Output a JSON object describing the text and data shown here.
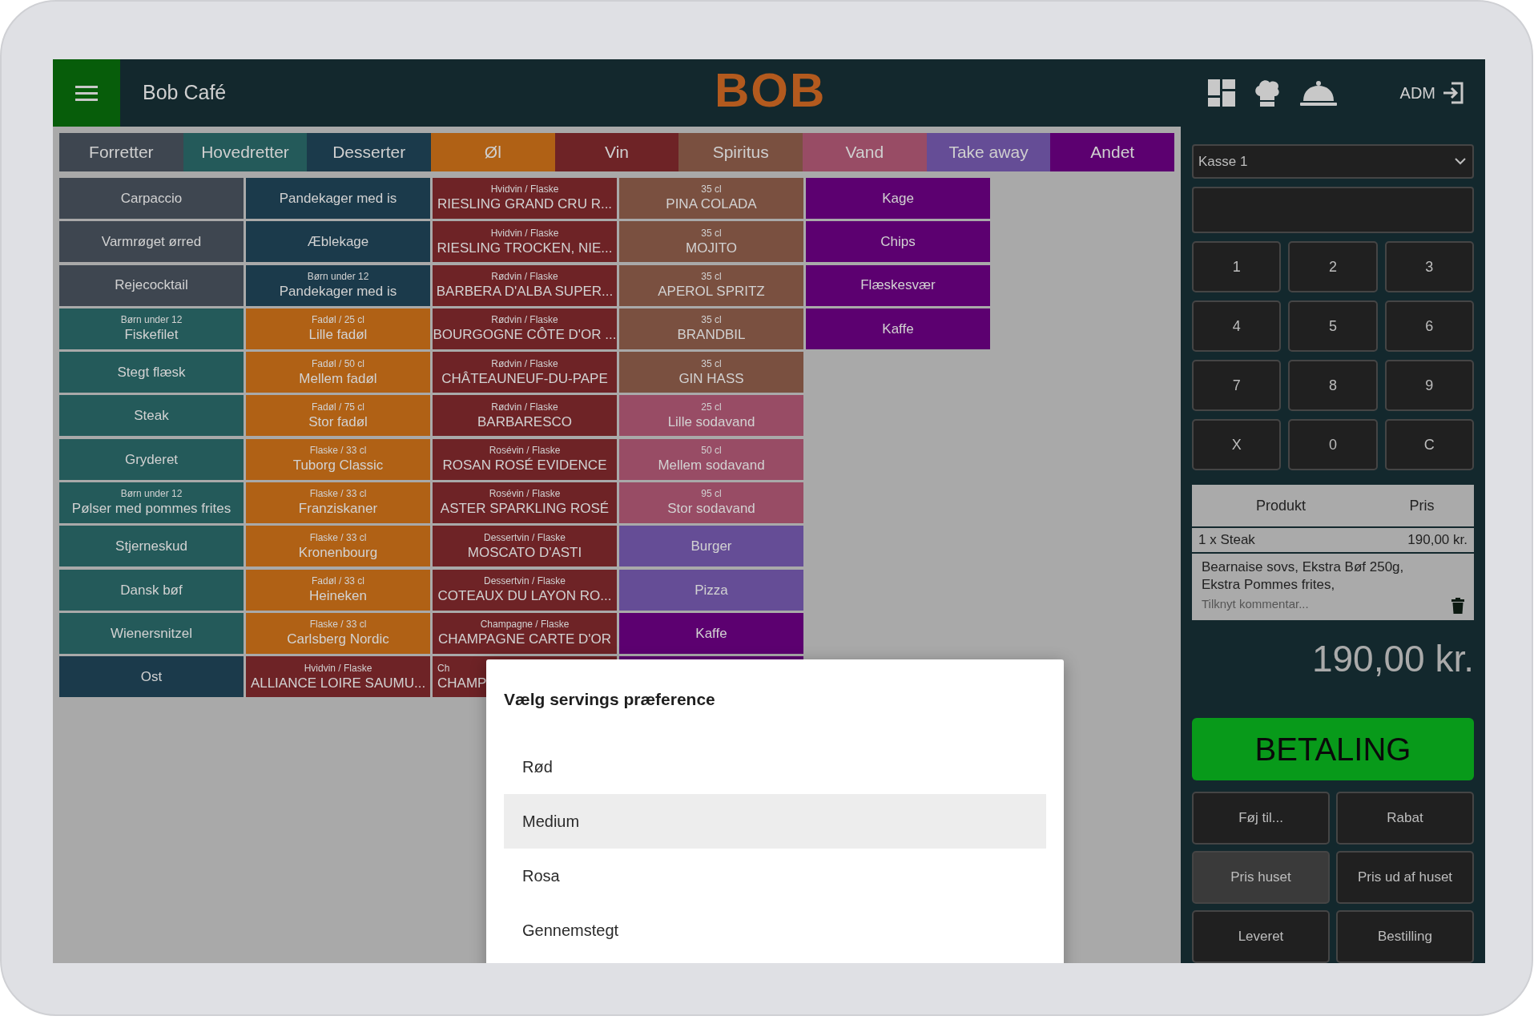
{
  "header": {
    "venue": "Bob Café",
    "logo": "BOB",
    "user": "ADM"
  },
  "categories": [
    {
      "label": "Forretter",
      "color": "#3e4650"
    },
    {
      "label": "Hovedretter",
      "color": "#245a5a"
    },
    {
      "label": "Desserter",
      "color": "#1b3a4b"
    },
    {
      "label": "Øl",
      "color": "#b06115"
    },
    {
      "label": "Vin",
      "color": "#6e2326"
    },
    {
      "label": "Spiritus",
      "color": "#7a5040"
    },
    {
      "label": "Vand",
      "color": "#984c65"
    },
    {
      "label": "Take away",
      "color": "#654d96"
    },
    {
      "label": "Andet",
      "color": "#5c0070"
    }
  ],
  "menu_columns": [
    [
      {
        "name": "Carpaccio",
        "color": "#3e4650"
      },
      {
        "name": "Varmrøget ørred",
        "color": "#3e4650"
      },
      {
        "name": "Rejecocktail",
        "color": "#3e4650"
      },
      {
        "subtitle": "Børn under 12",
        "name": "Fiskefilet",
        "color": "#245a5a"
      },
      {
        "name": "Stegt flæsk",
        "color": "#245a5a"
      },
      {
        "name": "Steak",
        "color": "#245a5a"
      },
      {
        "name": "Gryderet",
        "color": "#245a5a"
      },
      {
        "subtitle": "Børn under 12",
        "name": "Pølser med pommes frites",
        "color": "#245a5a"
      },
      {
        "name": "Stjerneskud",
        "color": "#245a5a"
      },
      {
        "name": "Dansk bøf",
        "color": "#245a5a"
      },
      {
        "name": "Wienersnitzel",
        "color": "#245a5a"
      },
      {
        "name": "Ost",
        "color": "#1b3a4b"
      }
    ],
    [
      {
        "name": "Pandekager med is",
        "color": "#1b3a4b"
      },
      {
        "name": "Æblekage",
        "color": "#1b3a4b"
      },
      {
        "subtitle": "Børn under 12",
        "name": "Pandekager med is",
        "color": "#1b3a4b"
      },
      {
        "subtitle": "Fadøl / 25 cl",
        "name": "Lille fadøl",
        "color": "#b06115"
      },
      {
        "subtitle": "Fadøl / 50 cl",
        "name": "Mellem fadøl",
        "color": "#b06115"
      },
      {
        "subtitle": "Fadøl / 75 cl",
        "name": "Stor fadøl",
        "color": "#b06115"
      },
      {
        "subtitle": "Flaske / 33 cl",
        "name": "Tuborg Classic",
        "color": "#b06115"
      },
      {
        "subtitle": "Flaske / 33 cl",
        "name": "Franziskaner",
        "color": "#b06115"
      },
      {
        "subtitle": "Flaske / 33 cl",
        "name": "Kronenbourg",
        "color": "#b06115"
      },
      {
        "subtitle": "Fadøl / 33 cl",
        "name": "Heineken",
        "color": "#b06115"
      },
      {
        "subtitle": "Flaske / 33 cl",
        "name": "Carlsberg Nordic",
        "color": "#b06115"
      },
      {
        "subtitle": "Hvidvin / Flaske",
        "name": "ALLIANCE LOIRE SAUMU...",
        "color": "#6e2326"
      }
    ],
    [
      {
        "subtitle": "Hvidvin / Flaske",
        "name": "RIESLING GRAND CRU R...",
        "color": "#6e2326"
      },
      {
        "subtitle": "Hvidvin / Flaske",
        "name": "RIESLING TROCKEN, NIE...",
        "color": "#6e2326"
      },
      {
        "subtitle": "Rødvin / Flaske",
        "name": "BARBERA D'ALBA SUPER...",
        "color": "#6e2326"
      },
      {
        "subtitle": "Rødvin / Flaske",
        "name": "BOURGOGNE CÔTE D'OR ...",
        "color": "#6e2326"
      },
      {
        "subtitle": "Rødvin / Flaske",
        "name": "CHÂTEAUNEUF-DU-PAPE",
        "color": "#6e2326"
      },
      {
        "subtitle": "Rødvin / Flaske",
        "name": "BARBARESCO",
        "color": "#6e2326"
      },
      {
        "subtitle": "Rosévin / Flaske",
        "name": "ROSAN ROSÉ EVIDENCE",
        "color": "#6e2326"
      },
      {
        "subtitle": "Rosévin / Flaske",
        "name": "ASTER SPARKLING ROSÉ",
        "color": "#6e2326"
      },
      {
        "subtitle": "Dessertvin / Flaske",
        "name": "MOSCATO D'ASTI",
        "color": "#6e2326"
      },
      {
        "subtitle": "Dessertvin / Flaske",
        "name": "COTEAUX DU LAYON RO...",
        "color": "#6e2326"
      },
      {
        "subtitle": "Champagne / Flaske",
        "name": "CHAMPAGNE CARTE D'OR",
        "color": "#6e2326"
      },
      {
        "subtitle": "Ch",
        "name": "CHAMP",
        "color": "#6e2326",
        "clipped": true
      }
    ],
    [
      {
        "subtitle": "35 cl",
        "name": "PINA COLADA",
        "color": "#7a5040"
      },
      {
        "subtitle": "35 cl",
        "name": "MOJITO",
        "color": "#7a5040"
      },
      {
        "subtitle": "35 cl",
        "name": "APEROL SPRITZ",
        "color": "#7a5040"
      },
      {
        "subtitle": "35 cl",
        "name": "BRANDBIL",
        "color": "#7a5040"
      },
      {
        "subtitle": "35 cl",
        "name": "GIN HASS",
        "color": "#7a5040"
      },
      {
        "subtitle": "25 cl",
        "name": "Lille sodavand",
        "color": "#984c65"
      },
      {
        "subtitle": "50 cl",
        "name": "Mellem sodavand",
        "color": "#984c65"
      },
      {
        "subtitle": "95 cl",
        "name": "Stor sodavand",
        "color": "#984c65"
      },
      {
        "name": "Burger",
        "color": "#654d96"
      },
      {
        "name": "Pizza",
        "color": "#654d96"
      },
      {
        "name": "Kaffe",
        "color": "#5c0070"
      },
      {
        "color": "#5c0070"
      }
    ],
    [
      {
        "name": "Kage",
        "color": "#5c0070"
      },
      {
        "name": "Chips",
        "color": "#5c0070"
      },
      {
        "name": "Flæskesvær",
        "color": "#5c0070"
      },
      {
        "name": "Kaffe",
        "color": "#5c0070"
      }
    ]
  ],
  "register": {
    "value": "Kasse 1"
  },
  "keypad": [
    "1",
    "2",
    "3",
    "4",
    "5",
    "6",
    "7",
    "8",
    "9",
    "X",
    "0",
    "C"
  ],
  "order_table": {
    "columns": [
      "Produkt",
      "Pris"
    ],
    "rows": [
      {
        "product": "1 x Steak",
        "price": "190,00 kr.",
        "modifiers": "Bearnaise sovs, Ekstra Bøf 250g, Ekstra Pommes frites,",
        "comment_placeholder": "Tilknyt kommentar..."
      }
    ]
  },
  "total": "190,00 kr.",
  "pay_button": "BETALING",
  "actions": [
    {
      "label": "Føj til...",
      "selected": false
    },
    {
      "label": "Rabat",
      "selected": false
    },
    {
      "label": "Pris huset",
      "selected": true
    },
    {
      "label": "Pris ud af huset",
      "selected": false
    },
    {
      "label": "Leveret",
      "selected": false
    },
    {
      "label": "Bestilling",
      "selected": false
    }
  ],
  "dialog": {
    "title": "Vælg servings præference",
    "options": [
      {
        "label": "Rød",
        "selected": false
      },
      {
        "label": "Medium",
        "selected": true
      },
      {
        "label": "Rosa",
        "selected": false
      },
      {
        "label": "Gennemstegt",
        "selected": false
      }
    ]
  }
}
